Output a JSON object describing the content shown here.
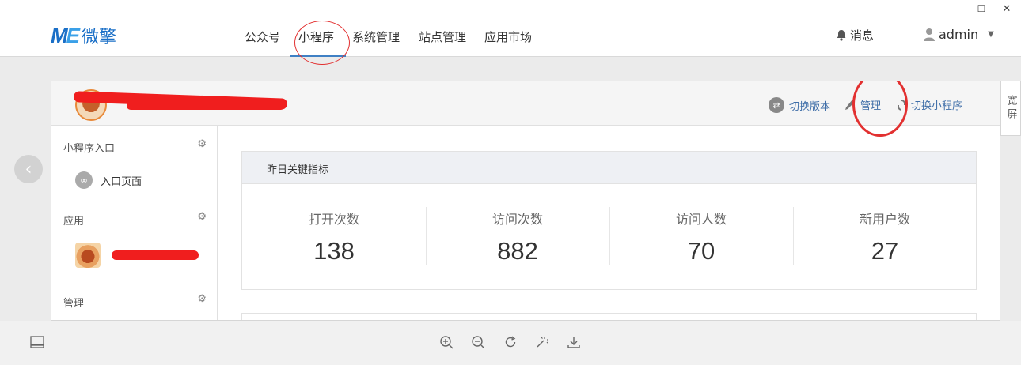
{
  "window": {
    "minimize_glyph": "—",
    "maximize_glyph": "☐",
    "close_glyph": "✕"
  },
  "nav": {
    "logo_text": "微擎",
    "items": [
      "公众号",
      "小程序",
      "系统管理",
      "站点管理",
      "应用市场"
    ],
    "active_index": 1,
    "messages_label": "消息",
    "user_name": "admin"
  },
  "header_actions": {
    "switch_version": "切换版本",
    "manage": "管理",
    "switch_miniapp": "切换小程序"
  },
  "wide_screen_label": "宽屏",
  "sidebar": {
    "sections": [
      {
        "title": "小程序入口",
        "links": [
          "入口页面"
        ]
      },
      {
        "title": "应用"
      },
      {
        "title": "管理"
      }
    ]
  },
  "metrics": {
    "title": "昨日关键指标",
    "items": [
      {
        "label": "打开次数",
        "value": "138"
      },
      {
        "label": "访问次数",
        "value": "882"
      },
      {
        "label": "访问人数",
        "value": "70"
      },
      {
        "label": "新用户数",
        "value": "27"
      }
    ]
  },
  "colors": {
    "accent": "#3f80c4",
    "annotation_red": "#e23030",
    "redaction": "#f01e1e"
  }
}
